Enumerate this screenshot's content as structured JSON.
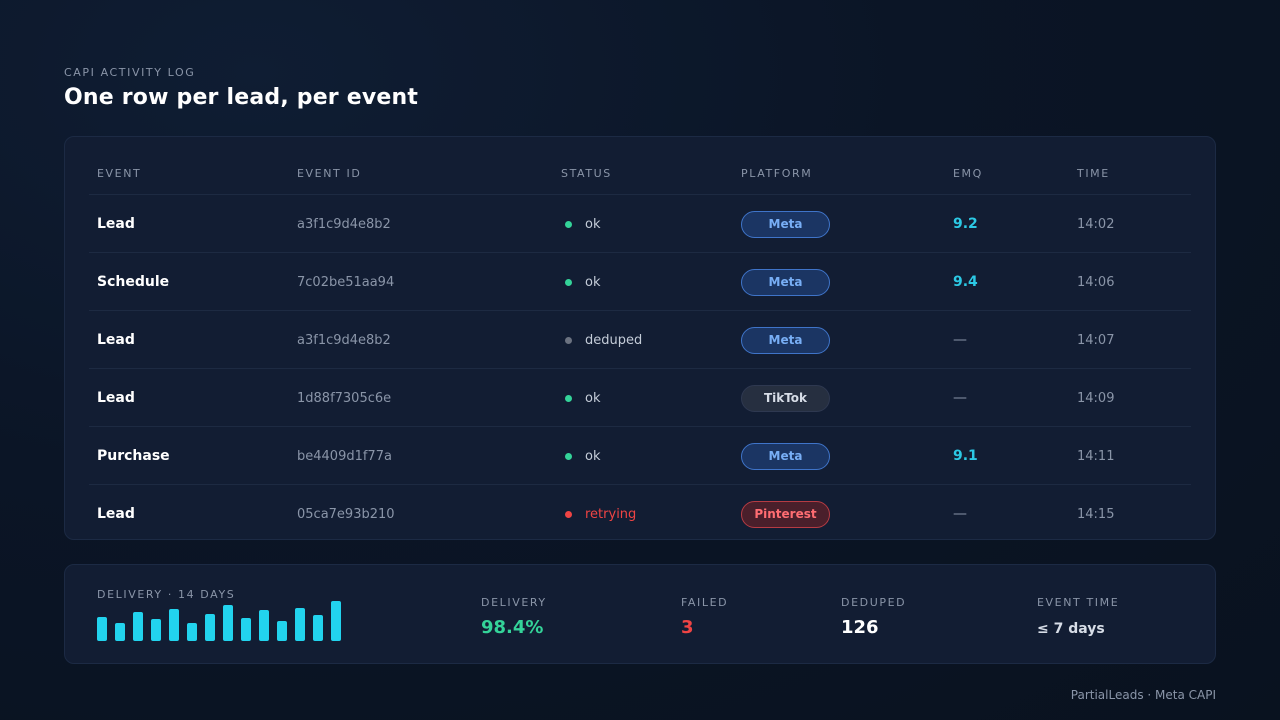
{
  "header": {
    "eyebrow": "CAPI ACTIVITY LOG",
    "title": "One row per lead, per event"
  },
  "table": {
    "columns": [
      "EVENT",
      "EVENT ID",
      "STATUS",
      "PLATFORM",
      "EMQ",
      "TIME"
    ],
    "rows": [
      {
        "event": "Lead",
        "event_id": "a3f1c9d4e8b2",
        "status": "ok",
        "status_color": "#34d399",
        "platform": "Meta",
        "emq": "9.2",
        "time": "14:02"
      },
      {
        "event": "Schedule",
        "event_id": "7c02be51aa94",
        "status": "ok",
        "status_color": "#34d399",
        "platform": "Meta",
        "emq": "9.4",
        "time": "14:06"
      },
      {
        "event": "Lead",
        "event_id": "a3f1c9d4e8b2",
        "status": "deduped",
        "status_color": "#6b7280",
        "platform": "Meta",
        "emq": "—",
        "time": "14:07"
      },
      {
        "event": "Lead",
        "event_id": "1d88f7305c6e",
        "status": "ok",
        "status_color": "#34d399",
        "platform": "TikTok",
        "emq": "—",
        "time": "14:09"
      },
      {
        "event": "Purchase",
        "event_id": "be4409d1f77a",
        "status": "ok",
        "status_color": "#34d399",
        "platform": "Meta",
        "emq": "9.1",
        "time": "14:11"
      },
      {
        "event": "Lead",
        "event_id": "05ca7e93b210",
        "status": "retrying",
        "status_color": "#ef4444",
        "platform": "Pinterest",
        "emq": "—",
        "time": "14:15"
      }
    ]
  },
  "stats": {
    "spark_label": "DELIVERY · 14 DAYS",
    "spark_color": "#22d3ee",
    "spark_values": [
      0.55,
      0.42,
      0.65,
      0.5,
      0.72,
      0.4,
      0.62,
      0.82,
      0.52,
      0.7,
      0.45,
      0.75,
      0.58,
      0.92
    ],
    "delivery_label": "DELIVERY",
    "delivery_value": "98.4%",
    "delivery_color": "#34d399",
    "failed_label": "FAILED",
    "failed_value": "3",
    "failed_color": "#ef4444",
    "deduped_label": "DEDUPED",
    "deduped_value": "126",
    "event_time_label": "EVENT TIME",
    "event_time_value": "≤ 7 days"
  },
  "footer": "PartialLeads · Meta CAPI"
}
